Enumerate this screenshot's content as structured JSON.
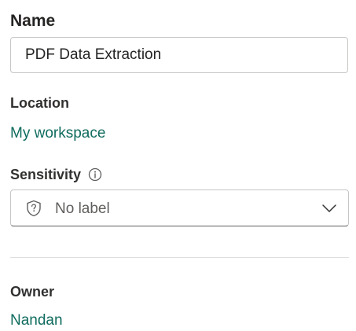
{
  "name_field": {
    "label": "Name",
    "value": "PDF Data Extraction"
  },
  "location": {
    "label": "Location",
    "link_text": "My workspace"
  },
  "sensitivity": {
    "label": "Sensitivity",
    "info_icon": "info-icon",
    "shield_icon": "shield-question-icon",
    "selected_value": "No label",
    "chevron_icon": "chevron-down-icon"
  },
  "owner": {
    "label": "Owner",
    "link_text": "Nandan"
  },
  "colors": {
    "link": "#106c5f",
    "border": "#c8c6c4",
    "divider": "#e1dfdd",
    "placeholder_text": "#605e5c"
  }
}
